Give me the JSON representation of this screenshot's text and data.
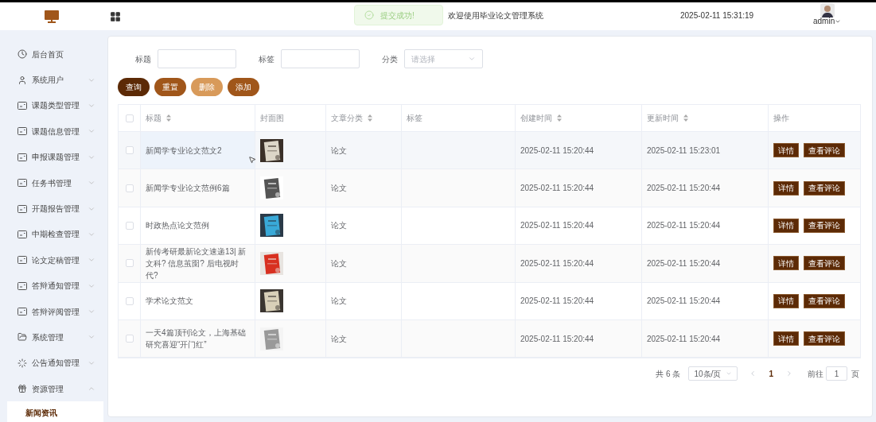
{
  "header": {
    "title": "欢迎使用毕业论文管理系统",
    "datetime": "2025-02-11 15:31:19",
    "user": "admin"
  },
  "toast": {
    "message": "提交成功!"
  },
  "sidebar": {
    "items": [
      {
        "label": "后台首页",
        "expanded": false,
        "has_children": false
      },
      {
        "label": "系统用户",
        "expanded": false,
        "has_children": true
      },
      {
        "label": "课题类型管理",
        "expanded": false,
        "has_children": true
      },
      {
        "label": "课题信息管理",
        "expanded": false,
        "has_children": true
      },
      {
        "label": "申报课题管理",
        "expanded": false,
        "has_children": true
      },
      {
        "label": "任务书管理",
        "expanded": false,
        "has_children": true
      },
      {
        "label": "开题报告管理",
        "expanded": false,
        "has_children": true
      },
      {
        "label": "中期检查管理",
        "expanded": false,
        "has_children": true
      },
      {
        "label": "论文定稿管理",
        "expanded": false,
        "has_children": true
      },
      {
        "label": "答辩通知管理",
        "expanded": false,
        "has_children": true
      },
      {
        "label": "答辩评阅管理",
        "expanded": false,
        "has_children": true
      },
      {
        "label": "系统管理",
        "expanded": false,
        "has_children": true
      },
      {
        "label": "公告通知管理",
        "expanded": false,
        "has_children": true
      },
      {
        "label": "资源管理",
        "expanded": true,
        "has_children": true,
        "children": [
          {
            "label": "新闻资讯",
            "selected": true
          }
        ]
      }
    ]
  },
  "filters": [
    {
      "label": "标题",
      "kind": "text"
    },
    {
      "label": "标签",
      "kind": "text"
    },
    {
      "label": "分类",
      "kind": "select",
      "placeholder": "请选择"
    }
  ],
  "buttons": [
    {
      "label": "查询",
      "color": "#5c2a06"
    },
    {
      "label": "重置",
      "color": "#a0561a"
    },
    {
      "label": "删除",
      "color": "#d89a5a"
    },
    {
      "label": "添加",
      "color": "#a0561a"
    }
  ],
  "table": {
    "all_checked": false,
    "columns": [
      {
        "label": "标题",
        "sortable": true
      },
      {
        "label": "封面图",
        "sortable": false
      },
      {
        "label": "文章分类",
        "sortable": true
      },
      {
        "label": "标签",
        "sortable": false
      },
      {
        "label": "创建时间",
        "sortable": true
      },
      {
        "label": "更新时间",
        "sortable": true
      },
      {
        "label": "操作",
        "sortable": false
      }
    ],
    "rows": [
      {
        "checked": false,
        "hovered": true,
        "title": "新闻学专业论文范文2",
        "category": "论文",
        "created": "2025-02-11 15:20:44",
        "updated": "2025-02-11 15:23:01",
        "actions": [
          "详情",
          "查看评论"
        ]
      },
      {
        "checked": false,
        "hovered": false,
        "title": "新闻学专业论文范例6篇",
        "category": "论文",
        "created": "2025-02-11 15:20:44",
        "updated": "2025-02-11 15:20:44",
        "actions": [
          "详情",
          "查看评论"
        ]
      },
      {
        "checked": false,
        "hovered": false,
        "title": "时政热点论文范例",
        "category": "论文",
        "created": "2025-02-11 15:20:44",
        "updated": "2025-02-11 15:20:44",
        "actions": [
          "详情",
          "查看评论"
        ]
      },
      {
        "checked": false,
        "hovered": false,
        "title": "新传考研最新论文速递13| 新文科? 信息茧囹? 后电视时代?",
        "category": "论文",
        "created": "2025-02-11 15:20:44",
        "updated": "2025-02-11 15:20:44",
        "actions": [
          "详情",
          "查看评论"
        ]
      },
      {
        "checked": false,
        "hovered": false,
        "title": "学术论文范文",
        "category": "论文",
        "created": "2025-02-11 15:20:44",
        "updated": "2025-02-11 15:20:44",
        "actions": [
          "详情",
          "查看评论"
        ]
      },
      {
        "checked": false,
        "hovered": false,
        "title": "一天4篇顶刊论文，上海基础研究喜迎“开门红”",
        "category": "论文",
        "created": "2025-02-11 15:20:44",
        "updated": "2025-02-11 15:20:44",
        "actions": [
          "详情",
          "查看评论"
        ]
      }
    ]
  },
  "pagination": {
    "total": "共 6 条",
    "page_size": "10条/页",
    "pages": [
      {
        "label": "1",
        "selected": true
      }
    ],
    "goto_label": "前往",
    "goto_value": "1",
    "goto_suffix": "页"
  }
}
